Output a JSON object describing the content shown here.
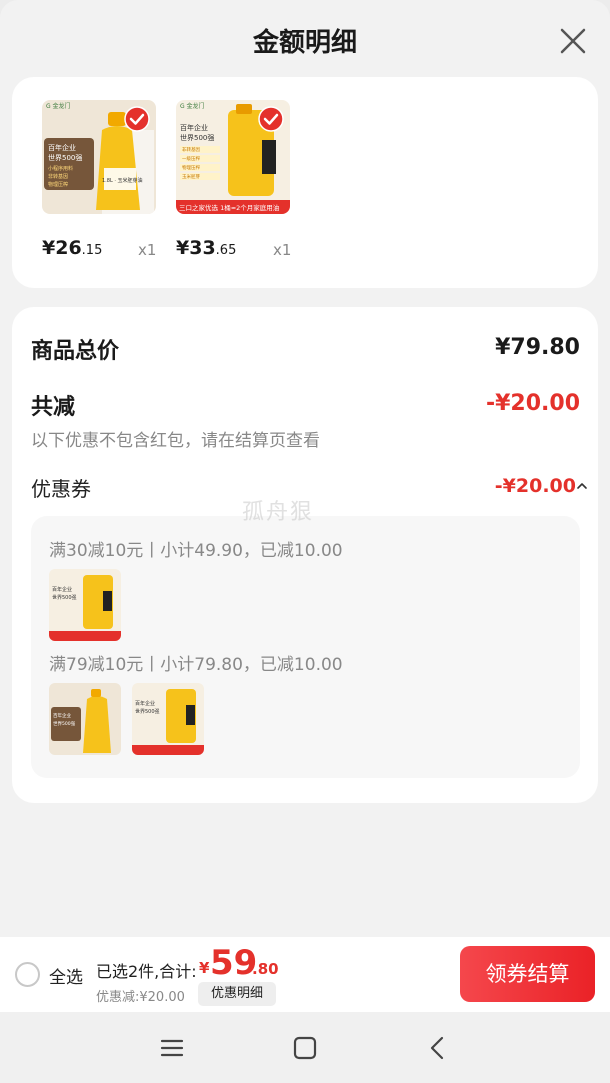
{
  "header": {
    "title": "金额明细"
  },
  "icons": {
    "close": "close-icon",
    "menu": "menu-icon",
    "home": "home-square-icon",
    "back": "back-chevron-icon",
    "expand": "chevron-up-icon",
    "check": "check-badge-icon"
  },
  "colors": {
    "accent_red": "#e4312b",
    "button_gradient_start": "#f5474c",
    "button_gradient_end": "#ea2227",
    "product_yellow": "#f6c21b"
  },
  "products": [
    {
      "price_int": "¥26",
      "price_dec": ".15",
      "qty": "x1",
      "img": {
        "brand": "G 金龙门",
        "lines": [
          "百年企业",
          "世界500强"
        ],
        "tags": [
          "小程序用料",
          "非转基因",
          "物理压榨"
        ],
        "sub": "1.8L · 玉米胚芽油"
      }
    },
    {
      "price_int": "¥33",
      "price_dec": ".65",
      "qty": "x1",
      "img": {
        "brand": "G 金龙门",
        "lines": [
          "百年企业",
          "世界500强"
        ],
        "tags": [
          "非转基因",
          "一级压榨",
          "物理压榨",
          "玉米胚芽"
        ],
        "strip": "三口之家优选 1桶≈2个月家庭用油"
      }
    }
  ],
  "summary": {
    "total_label": "商品总价",
    "total_value": "¥79.80",
    "reduce_label": "共减",
    "reduce_value": "-¥20.00",
    "note": "以下优惠不包含红包，请在结算页查看",
    "coupon_label": "优惠券",
    "coupon_value": "-¥20.00",
    "tiers": [
      {
        "text": "满30减10元丨小计49.90，已减10.00"
      },
      {
        "text": "满79减10元丨小计79.80，已减10.00"
      }
    ]
  },
  "watermark": "孤舟狠",
  "bottom": {
    "select_all": "全选",
    "selected_text": "已选2件,合计:",
    "total_symbol": "¥",
    "total_int": "59",
    "total_dec": ".80",
    "discount_text": "优惠减:¥20.00",
    "detail_button": "优惠明细",
    "checkout_button": "领券结算"
  }
}
